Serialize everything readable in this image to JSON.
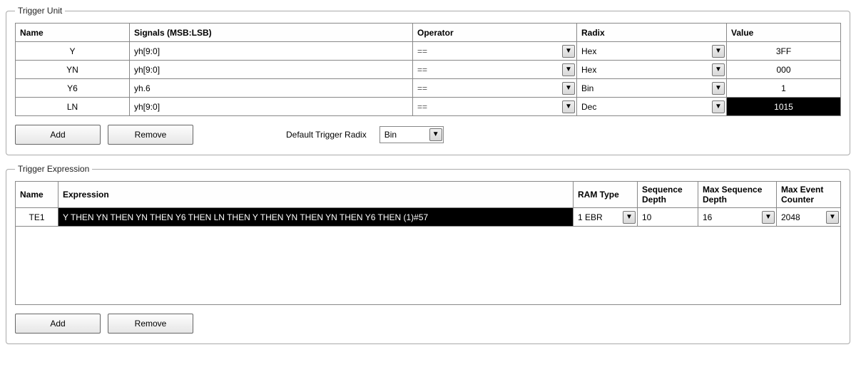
{
  "trigger_unit": {
    "legend": "Trigger Unit",
    "headers": {
      "name": "Name",
      "signals": "Signals (MSB:LSB)",
      "operator": "Operator",
      "radix": "Radix",
      "value": "Value"
    },
    "rows": [
      {
        "name": "Y",
        "signals": "yh[9:0]",
        "operator": "==",
        "radix": "Hex",
        "value": "3FF",
        "highlight": false
      },
      {
        "name": "YN",
        "signals": "yh[9:0]",
        "operator": "==",
        "radix": "Hex",
        "value": "000",
        "highlight": false
      },
      {
        "name": "Y6",
        "signals": "yh.6",
        "operator": "==",
        "radix": "Bin",
        "value": "1",
        "highlight": false
      },
      {
        "name": "LN",
        "signals": "yh[9:0]",
        "operator": "==",
        "radix": "Dec",
        "value": "1015",
        "highlight": true
      }
    ],
    "add_label": "Add",
    "remove_label": "Remove",
    "default_radix_label": "Default Trigger Radix",
    "default_radix_value": "Bin"
  },
  "trigger_expression": {
    "legend": "Trigger Expression",
    "headers": {
      "name": "Name",
      "expression": "Expression",
      "ram_type": "RAM Type",
      "seq_depth": "Sequence Depth",
      "max_seq_depth": "Max Sequence Depth",
      "max_event_counter": "Max Event Counter"
    },
    "rows": [
      {
        "name": "TE1",
        "expression": "Y THEN YN THEN YN THEN Y6 THEN LN THEN Y THEN YN THEN YN THEN Y6 THEN (1)#57",
        "ram_type": "1 EBR",
        "seq_depth": "10",
        "max_seq_depth": "16",
        "max_event_counter": "2048"
      }
    ],
    "add_label": "Add",
    "remove_label": "Remove"
  },
  "chart_data": {
    "type": "table",
    "tables": [
      {
        "name": "Trigger Unit",
        "columns": [
          "Name",
          "Signals (MSB:LSB)",
          "Operator",
          "Radix",
          "Value"
        ],
        "rows": [
          [
            "Y",
            "yh[9:0]",
            "==",
            "Hex",
            "3FF"
          ],
          [
            "YN",
            "yh[9:0]",
            "==",
            "Hex",
            "000"
          ],
          [
            "Y6",
            "yh.6",
            "==",
            "Bin",
            "1"
          ],
          [
            "LN",
            "yh[9:0]",
            "==",
            "Dec",
            "1015"
          ]
        ]
      },
      {
        "name": "Trigger Expression",
        "columns": [
          "Name",
          "Expression",
          "RAM Type",
          "Sequence Depth",
          "Max Sequence Depth",
          "Max Event Counter"
        ],
        "rows": [
          [
            "TE1",
            "Y THEN YN THEN YN THEN Y6 THEN LN THEN Y THEN YN THEN YN THEN Y6 THEN (1)#57",
            "1 EBR",
            "10",
            "16",
            "2048"
          ]
        ]
      }
    ]
  }
}
